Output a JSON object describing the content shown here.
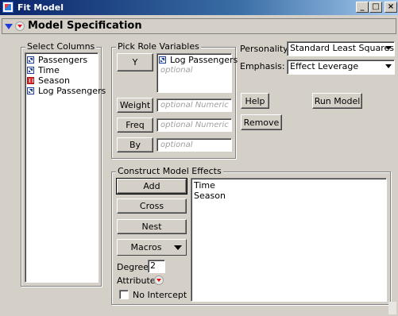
{
  "window": {
    "title": "Fit Model",
    "minimize_label": "_",
    "maximize_label": "□",
    "close_label": "×"
  },
  "outline": {
    "title": "Model Specification"
  },
  "select_columns": {
    "label": "Select Columns",
    "columns": [
      {
        "name": "Passengers",
        "icon": "continuous-column-icon"
      },
      {
        "name": "Time",
        "icon": "continuous-column-icon"
      },
      {
        "name": "Season",
        "icon": "nominal-column-icon"
      },
      {
        "name": "Log Passengers",
        "icon": "continuous-column-icon"
      }
    ]
  },
  "pick_role": {
    "label": "Pick Role Variables",
    "y_button": "Y",
    "y_value": "Log Passengers",
    "y_placeholder": "optional",
    "weight_button": "Weight",
    "weight_placeholder": "optional Numeric",
    "freq_button": "Freq",
    "freq_placeholder": "optional Numeric",
    "by_button": "By",
    "by_placeholder": "optional"
  },
  "settings": {
    "personality_label": "Personality:",
    "personality_value": "Standard Least Squares",
    "emphasis_label": "Emphasis:",
    "emphasis_value": "Effect Leverage"
  },
  "actions": {
    "help": "Help",
    "run_model": "Run Model",
    "remove": "Remove"
  },
  "construct": {
    "label": "Construct Model Effects",
    "add": "Add",
    "cross": "Cross",
    "nest": "Nest",
    "macros": "Macros",
    "degree_label": "Degree",
    "degree_value": "2",
    "attributes_label": "Attributes",
    "no_intercept_label": "No Intercept",
    "no_intercept_checked": false,
    "effects": [
      "Time",
      "Season"
    ]
  },
  "colors": {
    "title_bar_start": "#0a246a",
    "title_bar_end": "#a6caf0",
    "face": "#d4d0c8",
    "disclosure_blue": "#1d3ed6",
    "red_triangle": "#e01010"
  }
}
